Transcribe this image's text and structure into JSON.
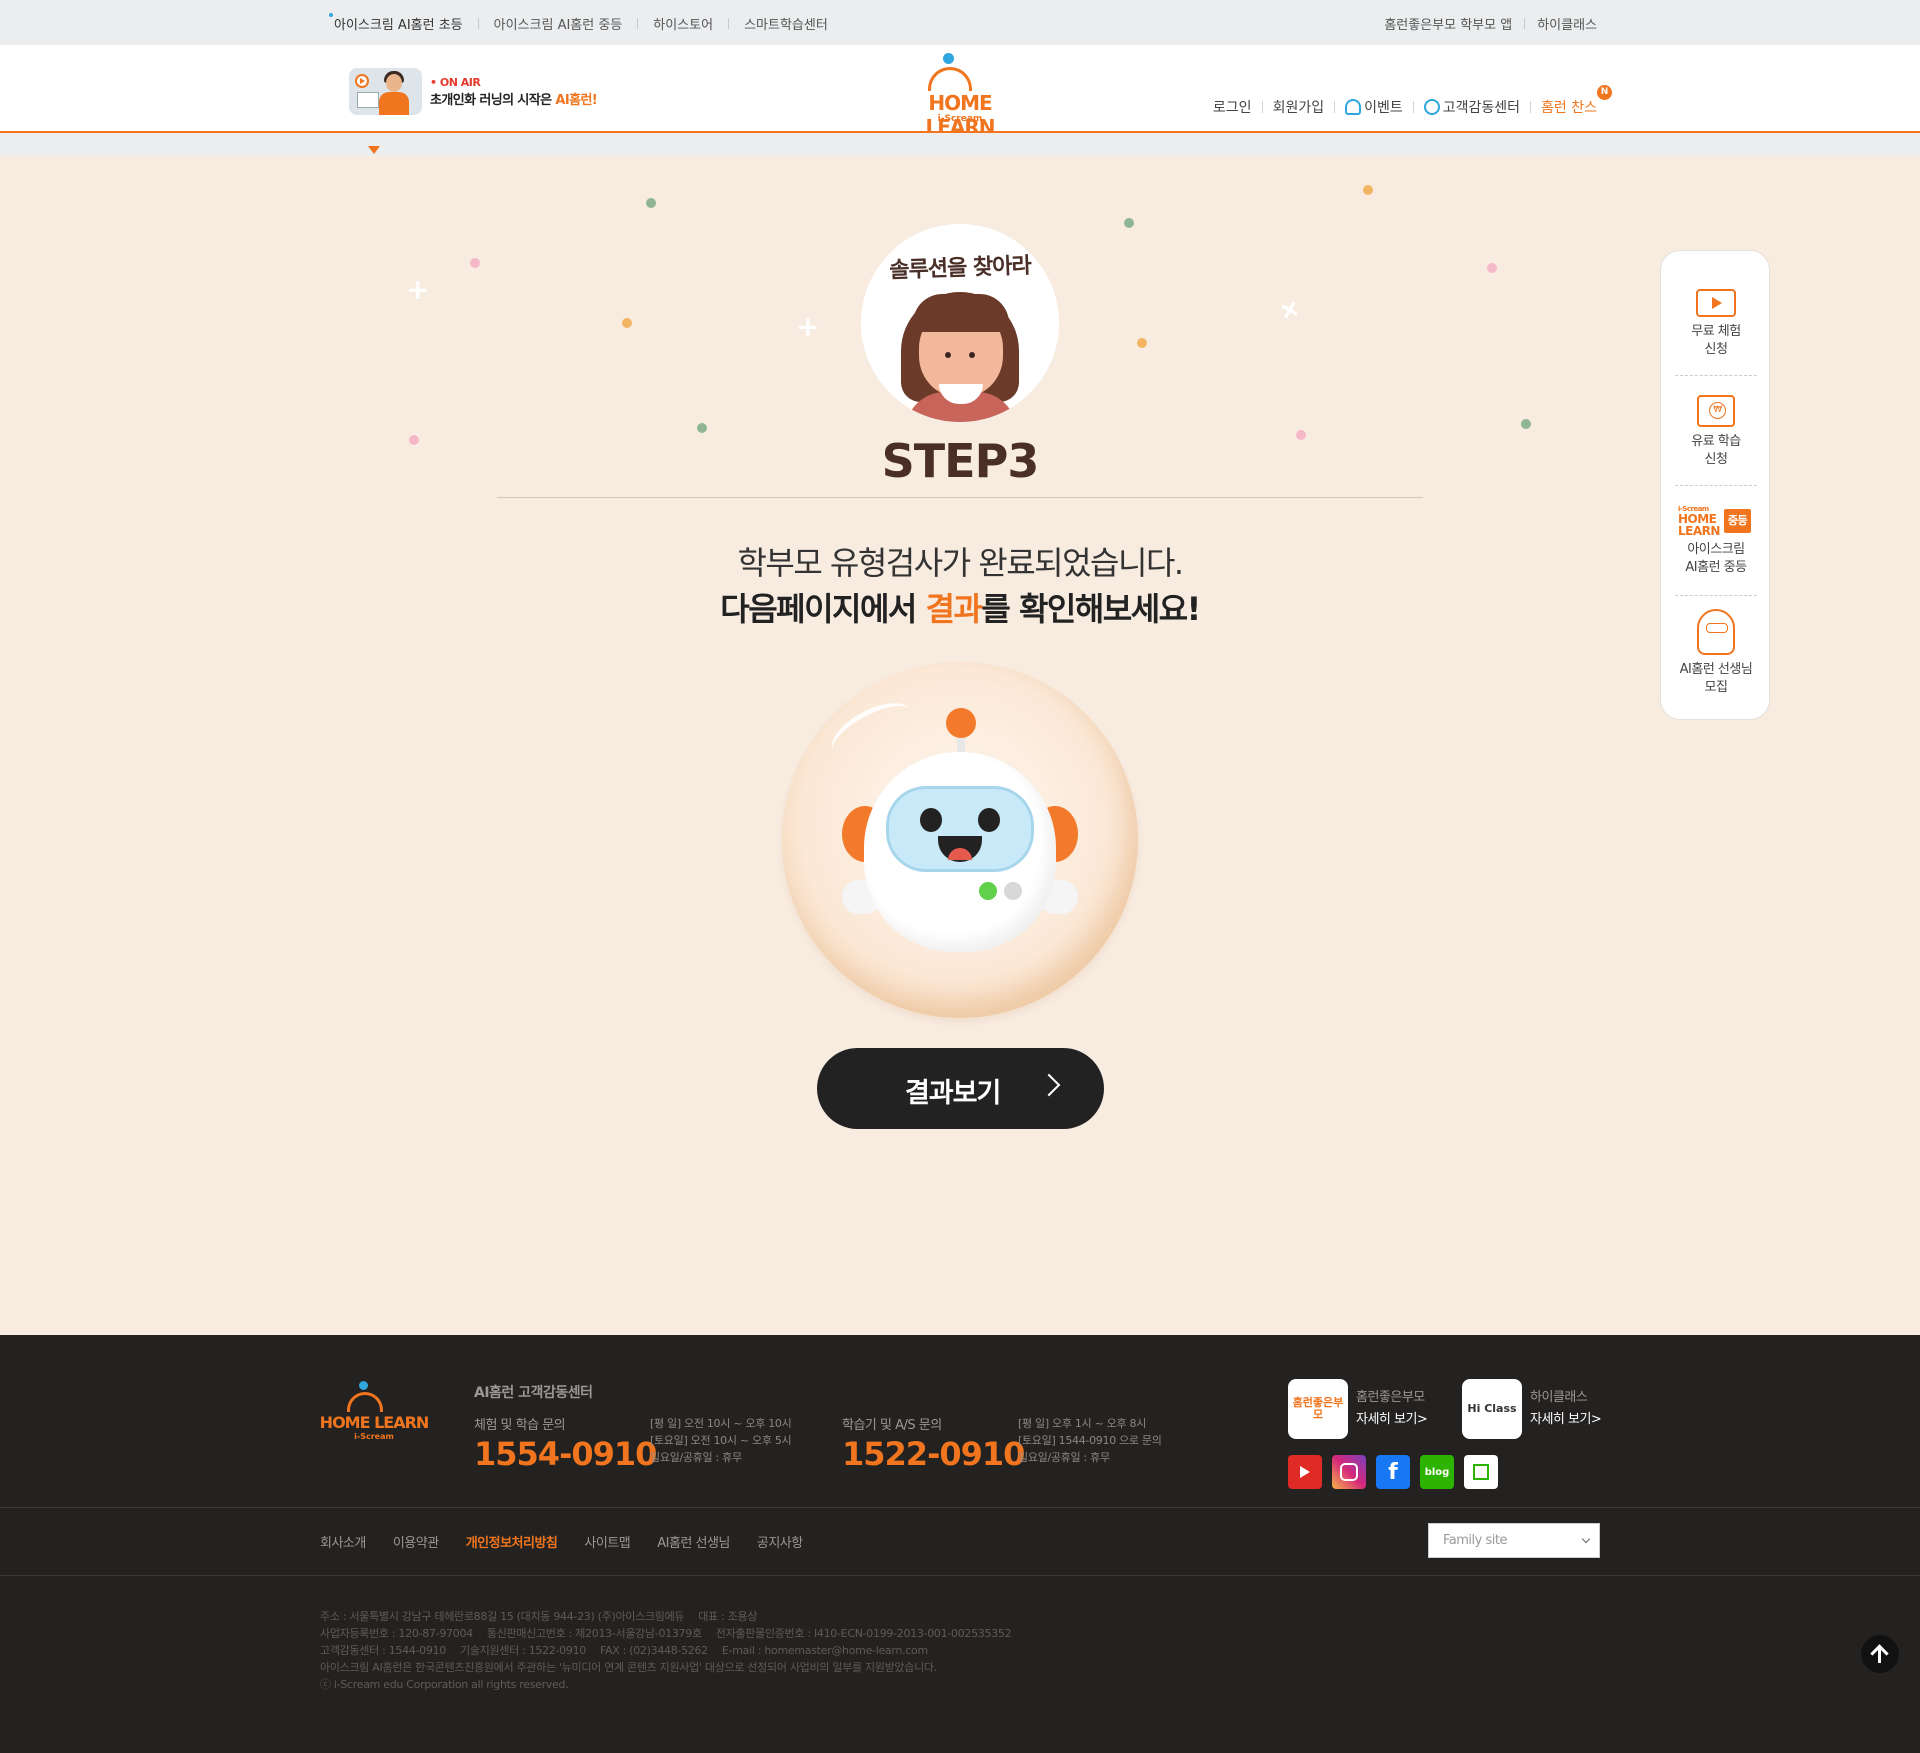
{
  "topbar": {
    "links": [
      "아이스크림 AI홈런 초등",
      "아이스크림 AI홈런 중등",
      "하이스토어",
      "스마트학습센터"
    ],
    "right": [
      "홈런좋은부모 학부모 앱",
      "하이클래스"
    ]
  },
  "header": {
    "onair_label": "• ON AIR",
    "slogan_prefix": "초개인화 러닝의 시작은 ",
    "slogan_highlight": "AI홈런!",
    "logo_text": "HOME LEARN",
    "logo_sub": "i-Scream",
    "nav": {
      "login": "로그인",
      "signup": "회원가입",
      "event": "이벤트",
      "support": "고객감동센터",
      "chance": "홈런 찬스",
      "chance_badge": "N"
    }
  },
  "main": {
    "badge_title": "솔루션을 찾아라",
    "step": "STEP3",
    "message_line1": "학부모 유형검사가 완료되었습니다.",
    "message_line2_prefix": "다음페이지에서 ",
    "message_line2_highlight": "결과",
    "message_line2_suffix": "를 확인해보세요!",
    "cta_label": "결과보기"
  },
  "quick_menu": {
    "free_trial": [
      "무료 체험",
      "신청"
    ],
    "paid_study": [
      "유료 학습",
      "신청"
    ],
    "middle_logo_top": "i-Scream",
    "middle_logo_word1": "HOME",
    "middle_logo_word2": "LEARN",
    "middle_logo_tag": "중등",
    "middle": [
      "아이스크림",
      "AI홈런 중등"
    ],
    "teacher": [
      "AI홈런 선생님",
      "모집"
    ]
  },
  "footer": {
    "logo_text": "HOME LEARN",
    "logo_sub": "i-Scream",
    "cs_title": "AI홈런 고객감동센터",
    "trial_label": "체험 및 학습 문의",
    "trial_number": "1554-0910",
    "trial_hours": [
      "[평 일] 오전 10시 ~ 오후 10시",
      "[토요일] 오전 10시 ~ 오후 5시",
      "일요일/공휴일 : 휴무"
    ],
    "as_label": "학습기 및 A/S 문의",
    "as_number": "1522-0910",
    "as_hours": [
      "[평 일] 오후 1시 ~ 오후 8시",
      "[토요일] 1544-0910 으로 문의",
      "일요일/공휴일 : 휴무"
    ],
    "app1_icon": "홈런좋은부모",
    "app1_name": "홈런좋은부모",
    "app1_more": "자세히 보기>",
    "app2_icon": "Hi Class",
    "app2_name": "하이클래스",
    "app2_more": "자세히 보기>",
    "sns": [
      "YouTube",
      "Instagram",
      "f",
      "blog",
      "post"
    ],
    "nav": [
      "회사소개",
      "이용약관",
      "개인정보처리방침",
      "사이트맵",
      "AI홈런 선생님",
      "공지사항"
    ],
    "family_site": "Family site",
    "address": "주소 : 서울특별시 강남구 테헤란로88길 15 (대치동 944-23) (주)아이스크림에듀",
    "ceo": "대표 : 조용상",
    "biz_no": "사업자등록번호 : 120-87-97004",
    "mail_order": "통신판매신고번호 : 제2013-서울강남-01379호",
    "cert": "전자출판물인증번호 : I410-ECN-0199-2013-001-002535352",
    "cs_phone": "고객감동센터 : 1544-0910",
    "tech_phone": "기술지원센터 : 1522-0910",
    "fax": "FAX : (02)3448-5262",
    "email": "E-mail : homemaster@home-learn.com",
    "notice": "아이스크림 AI홈런은 한국콘텐츠진흥원에서 주관하는 '뉴미디어 연계 콘텐츠 지원사업' 대상으로 선정되어 사업비의 일부를 지원받았습니다.",
    "copyright": "ⓒ i-Scream edu Corporation all rights reserved."
  }
}
